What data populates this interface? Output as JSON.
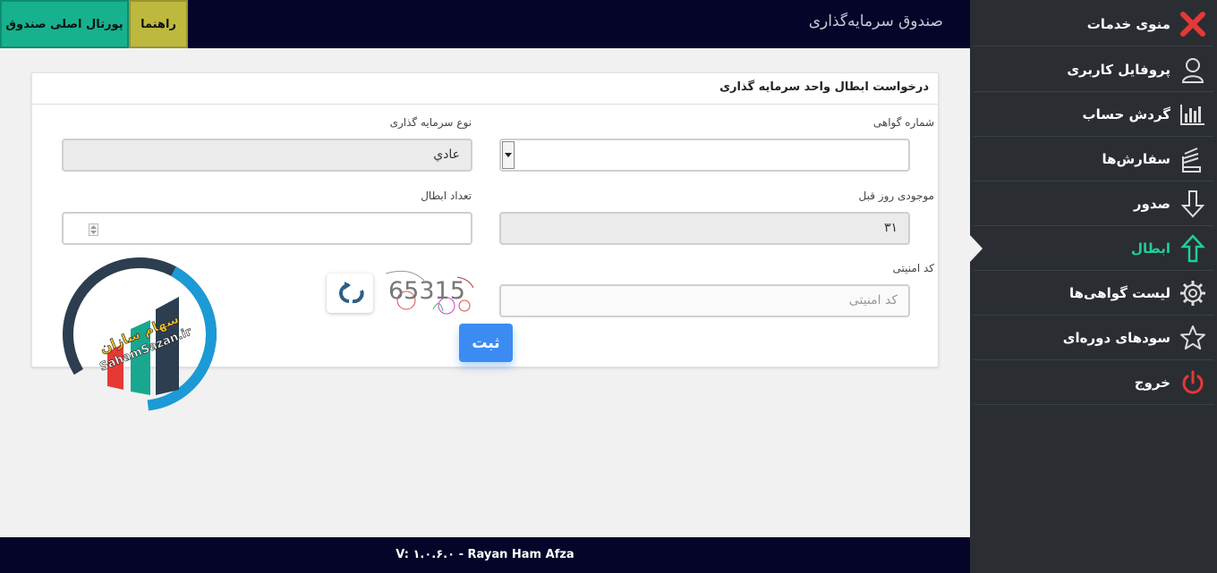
{
  "header": {
    "title": "صندوق سرمایه‌گذاری",
    "portal_button": "پورتال اصلی صندوق",
    "help_button": "راهنما"
  },
  "sidebar": {
    "items": [
      {
        "label": "منوی خدمات",
        "icon": "close-icon"
      },
      {
        "label": "پروفایل کاربری",
        "icon": "user-icon"
      },
      {
        "label": "گردش حساب",
        "icon": "bar-chart-icon"
      },
      {
        "label": "سفارش‌ها",
        "icon": "orders-icon"
      },
      {
        "label": "صدور",
        "icon": "arrow-down-icon"
      },
      {
        "label": "ابطال",
        "icon": "arrow-up-icon",
        "active": true
      },
      {
        "label": "لیست گواهی‌ها",
        "icon": "gear-icon"
      },
      {
        "label": "سودهای دوره‌ای",
        "icon": "star-icon"
      },
      {
        "label": "خروج",
        "icon": "power-icon"
      }
    ]
  },
  "form": {
    "title": "درخواست ابطال واحد سرمایه گذاری",
    "certificate_label": "شماره گواهی",
    "certificate_value": "",
    "investment_type_label": "نوع سرمایه گذاری",
    "investment_type_value": "عادي",
    "prev_balance_label": "موجودی روز قبل",
    "prev_balance_value": "۳۱",
    "cancel_count_label": "تعداد ابطال",
    "cancel_count_value": "",
    "security_code_label": "کد امنیتی",
    "security_code_placeholder": "کد امنیتی",
    "captcha_text": "65315",
    "submit_label": "ثبت"
  },
  "watermark": {
    "text_fa": "سهام سازان",
    "text_en": "SahamSazan.ir"
  },
  "footer": {
    "text": "V: ۱.۰.۶.۰ - Rayan Ham Afza"
  },
  "colors": {
    "topbar": "#05052a",
    "sidebar": "#2a2e33",
    "active": "#1fcf9a",
    "portal_button": "#17b18f",
    "help_button": "#bdb83e",
    "submit": "#3b8cf2",
    "exit_icon": "#e53935"
  }
}
